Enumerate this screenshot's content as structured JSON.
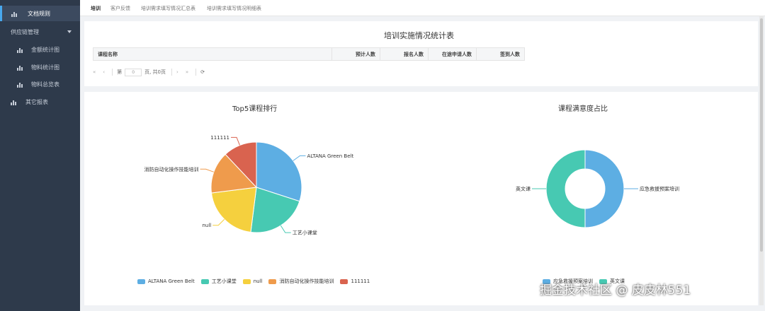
{
  "sidebar": {
    "items": [
      {
        "label": "文档规则",
        "icon": "bar-chart-icon"
      },
      {
        "label": "供应链管理",
        "icon": "none"
      },
      {
        "label": "金额统计图",
        "icon": "bar-chart-icon"
      },
      {
        "label": "物料统计图",
        "icon": "bar-chart-icon"
      },
      {
        "label": "物料总览表",
        "icon": "bar-chart-icon"
      },
      {
        "label": "其它报表",
        "icon": "bar-chart-icon"
      }
    ]
  },
  "tabs": [
    "培训",
    "客户反馈",
    "培训需求填写情况汇总表",
    "培训需求填写情况明细表"
  ],
  "report": {
    "title": "培训实施情况统计表",
    "columns": [
      "课程名称",
      "预计人数",
      "报名人数",
      "在途申请人数",
      "签到人数"
    ]
  },
  "pager": {
    "page_prefix": "第",
    "page_value": "0",
    "page_suffix": "页, 共0页"
  },
  "pie": {
    "title": "Top5课程排行",
    "slices": [
      {
        "name": "ALTANA Green Belt",
        "value": 30,
        "color": "#5daee3"
      },
      {
        "name": "工艺小课堂",
        "value": 22,
        "color": "#47c9b2"
      },
      {
        "name": "null",
        "value": 21,
        "color": "#f5d03e"
      },
      {
        "name": "消防自动化操作技能培训",
        "value": 15,
        "color": "#ef9b4c"
      },
      {
        "name": "111111",
        "value": 12,
        "color": "#d9634f"
      }
    ]
  },
  "donut": {
    "title": "课程满意度占比",
    "slices": [
      {
        "name": "应急救援预案培训",
        "value": 50,
        "color": "#5daee3"
      },
      {
        "name": "英文课",
        "value": 50,
        "color": "#47c9b2"
      }
    ]
  },
  "watermark": "掘金技术社区 @ 皮皮林551"
}
